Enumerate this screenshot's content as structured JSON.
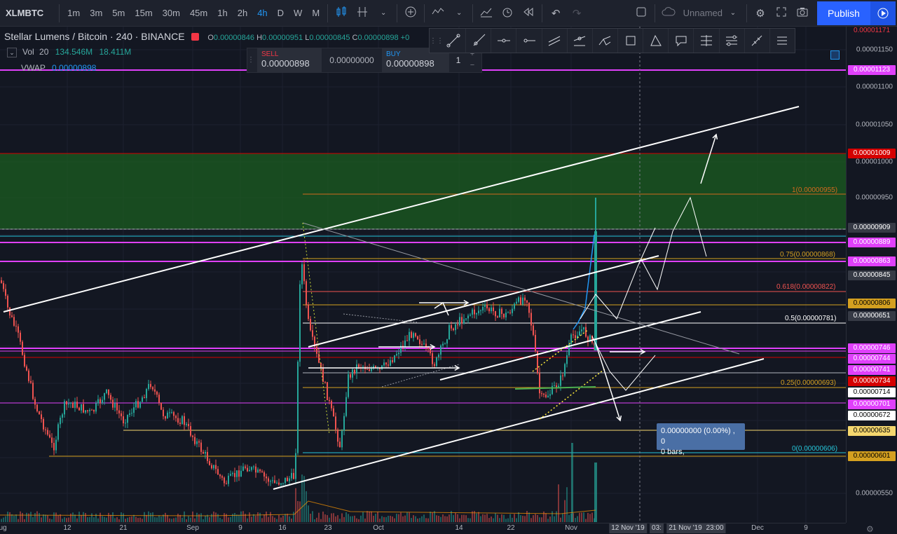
{
  "toolbar": {
    "symbol": "XLMBTC",
    "timeframes": [
      {
        "label": "1m",
        "active": false
      },
      {
        "label": "3m",
        "active": false
      },
      {
        "label": "5m",
        "active": false
      },
      {
        "label": "15m",
        "active": false
      },
      {
        "label": "30m",
        "active": false
      },
      {
        "label": "45m",
        "active": false
      },
      {
        "label": "1h",
        "active": false
      },
      {
        "label": "2h",
        "active": false
      },
      {
        "label": "4h",
        "active": true
      },
      {
        "label": "D",
        "active": false
      },
      {
        "label": "W",
        "active": false
      },
      {
        "label": "M",
        "active": false
      }
    ],
    "layout_name": "Unnamed",
    "publish_label": "Publish"
  },
  "legend": {
    "title": "Stellar Lumens / Bitcoin · 240 · BINANCE",
    "open_label": "O",
    "open": "0.00000846",
    "high_label": "H",
    "high": "0.00000951",
    "low_label": "L",
    "low": "0.00000845",
    "close_label": "C",
    "close": "0.00000898",
    "change": "+0"
  },
  "indicators": {
    "vol_label": "Vol",
    "vol_period": "20",
    "vol_value": "134.546M",
    "vol_ma": "18.411M",
    "vwap_label": "VWAP",
    "vwap_value": "0.00000898"
  },
  "trade_panel": {
    "sell_label": "SELL",
    "sell_price": "0.00000898",
    "spread": "0.00000000",
    "buy_label": "BUY",
    "buy_price": "0.00000898",
    "quantity": "1"
  },
  "tooltip": {
    "line1": "0.00000000 (0.00%) , 0",
    "line2": "0 bars,"
  },
  "price_axis": {
    "ticks": [
      "0.00001150",
      "0.00001100",
      "0.00001050",
      "0.00001000",
      "0.00000950",
      "0.00000550"
    ],
    "labels": [
      {
        "text": "0.00001171",
        "bg": "none",
        "fg": "#f23645"
      },
      {
        "text": "0.00001123",
        "bg": "#e040fb",
        "fg": "#ffffff"
      },
      {
        "text": "0.00001009",
        "bg": "#d50000",
        "fg": "#ffffff"
      },
      {
        "text": "0.00000909",
        "bg": "#363a45",
        "fg": "#ffffff"
      },
      {
        "text": "0.00000889",
        "bg": "#e040fb",
        "fg": "#ffffff"
      },
      {
        "text": "0.00000863",
        "bg": "#e040fb",
        "fg": "#ffffff"
      },
      {
        "text": "0.00000845",
        "bg": "#363a45",
        "fg": "#ffffff"
      },
      {
        "text": "0.00000806",
        "bg": "#d4a020",
        "fg": "#000000"
      },
      {
        "text": "0.00000651",
        "bg": "#363a45",
        "fg": "#ffffff"
      },
      {
        "text": "0.00000746",
        "bg": "#e040fb",
        "fg": "#ffffff"
      },
      {
        "text": "0.00000744",
        "bg": "#e040fb",
        "fg": "#ffffff"
      },
      {
        "text": "0.00000741",
        "bg": "#e040fb",
        "fg": "#ffffff"
      },
      {
        "text": "0.00000734",
        "bg": "#d50000",
        "fg": "#ffffff"
      },
      {
        "text": "0.00000714",
        "bg": "#ffffff",
        "fg": "#000000"
      },
      {
        "text": "0.00000701",
        "bg": "#e040fb",
        "fg": "#ffffff"
      },
      {
        "text": "0.00000672",
        "bg": "#ffffff",
        "fg": "#000000"
      },
      {
        "text": "0.00000635",
        "bg": "#f5d76e",
        "fg": "#000000"
      },
      {
        "text": "0.00000601",
        "bg": "#d4a020",
        "fg": "#000000"
      }
    ]
  },
  "fib_levels": [
    {
      "text": "1(0.00000955)",
      "color": "#d2691e"
    },
    {
      "text": "0.75(0.00000868)",
      "color": "#d4a020"
    },
    {
      "text": "0.618(0.00000822)",
      "color": "#ef5350"
    },
    {
      "text": "0.5(0.00000781)",
      "color": "#ffffff"
    },
    {
      "text": "0.25(0.00000693)",
      "color": "#d4a020"
    },
    {
      "text": "0(0.00000606)",
      "color": "#26c6da"
    }
  ],
  "time_axis": {
    "ticks": [
      "ug",
      "12",
      "21",
      "Sep",
      "9",
      "16",
      "23",
      "Oct",
      "14",
      "22",
      "Nov",
      "Dec",
      "9"
    ],
    "labels": [
      "12 Nov '19",
      "03:",
      "21 Nov '19",
      "23:00"
    ]
  },
  "colors": {
    "up": "#26a69a",
    "down": "#ef5350",
    "background": "#131722",
    "accent": "#2962ff"
  }
}
